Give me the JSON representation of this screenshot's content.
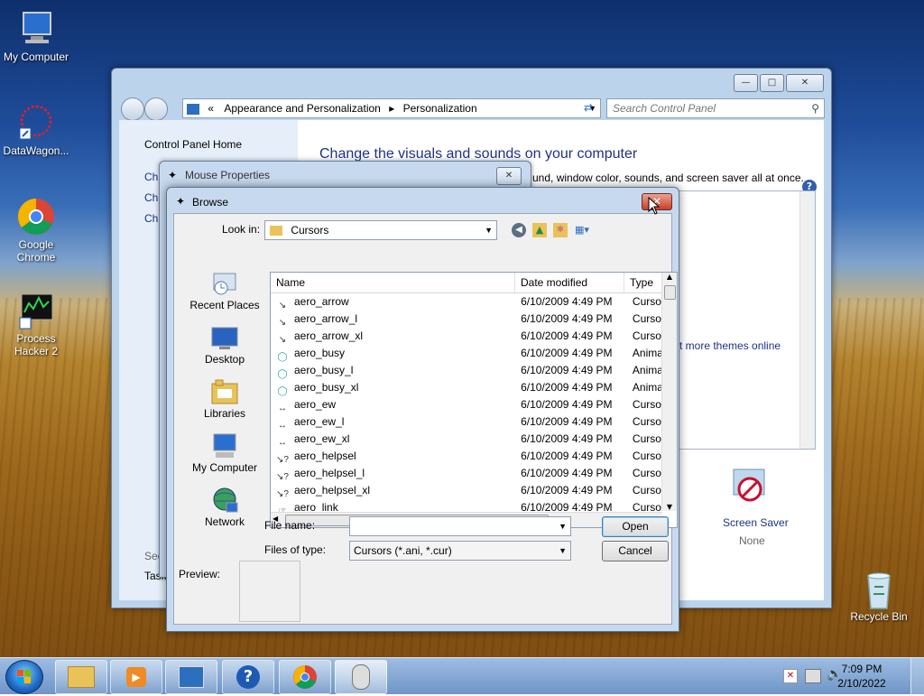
{
  "desktop": {
    "icons": [
      {
        "label": "My Computer"
      },
      {
        "label": "DataWagon..."
      },
      {
        "label": "Google Chrome"
      },
      {
        "label": "Process Hacker 2"
      },
      {
        "label": "Recycle Bin"
      }
    ]
  },
  "control_panel": {
    "breadcrumb": [
      "Appearance and Personalization",
      "Personalization"
    ],
    "search_placeholder": "Search Control Panel",
    "left_home": "Control Panel Home",
    "left_links": [
      "Ch",
      "Ch",
      "Ch"
    ],
    "left_see": "See",
    "left_task": "Task",
    "heading": "Change the visuals and sounds on your computer",
    "subheading": "und, window color, sounds, and screen saver all at once.",
    "more_themes": "t more themes online",
    "screen_saver_label": "Screen Saver",
    "screen_saver_value": "None"
  },
  "mouse_properties": {
    "title": "Mouse Properties"
  },
  "browse": {
    "title": "Browse",
    "look_in_label": "Look in:",
    "look_in_value": "Cursors",
    "places": [
      "Recent Places",
      "Desktop",
      "Libraries",
      "My Computer",
      "Network"
    ],
    "columns": [
      "Name",
      "Date modified",
      "Type"
    ],
    "files": [
      {
        "name": "aero_arrow",
        "date": "6/10/2009 4:49 PM",
        "type": "Cursor"
      },
      {
        "name": "aero_arrow_l",
        "date": "6/10/2009 4:49 PM",
        "type": "Cursor"
      },
      {
        "name": "aero_arrow_xl",
        "date": "6/10/2009 4:49 PM",
        "type": "Cursor"
      },
      {
        "name": "aero_busy",
        "date": "6/10/2009 4:49 PM",
        "type": "Anima"
      },
      {
        "name": "aero_busy_l",
        "date": "6/10/2009 4:49 PM",
        "type": "Anima"
      },
      {
        "name": "aero_busy_xl",
        "date": "6/10/2009 4:49 PM",
        "type": "Anima"
      },
      {
        "name": "aero_ew",
        "date": "6/10/2009 4:49 PM",
        "type": "Cursor"
      },
      {
        "name": "aero_ew_l",
        "date": "6/10/2009 4:49 PM",
        "type": "Cursor"
      },
      {
        "name": "aero_ew_xl",
        "date": "6/10/2009 4:49 PM",
        "type": "Cursor"
      },
      {
        "name": "aero_helpsel",
        "date": "6/10/2009 4:49 PM",
        "type": "Cursor"
      },
      {
        "name": "aero_helpsel_l",
        "date": "6/10/2009 4:49 PM",
        "type": "Cursor"
      },
      {
        "name": "aero_helpsel_xl",
        "date": "6/10/2009 4:49 PM",
        "type": "Cursor"
      },
      {
        "name": "aero_link",
        "date": "6/10/2009 4:49 PM",
        "type": "Cursor"
      }
    ],
    "file_name_label": "File name:",
    "file_name_value": "",
    "files_of_type_label": "Files of type:",
    "files_of_type_value": "Cursors (*.ani, *.cur)",
    "open_label": "Open",
    "cancel_label": "Cancel",
    "preview_label": "Preview:"
  },
  "taskbar": {
    "time": "7:09 PM",
    "date": "2/10/2022"
  }
}
